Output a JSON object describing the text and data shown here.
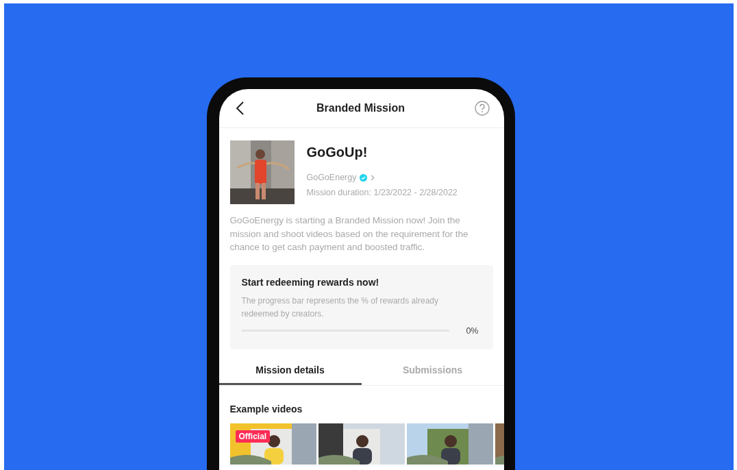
{
  "header": {
    "title": "Branded Mission"
  },
  "mission": {
    "name": "GoGoUp!",
    "brand": "GoGoEnergy",
    "verified": true,
    "duration": "Mission duration: 1/23/2022 - 2/28/2022",
    "description": "GoGoEnergy is starting a Branded Mission now! Join the mission and shoot videos based on the requirement for the chance to get cash payment and boosted traffic."
  },
  "rewards": {
    "title": "Start redeeming rewards now!",
    "note": "The progress bar represents the % of rewards already redeemed by creators.",
    "level": 0,
    "reading": "0%"
  },
  "tabs": [
    {
      "label": "Mission details",
      "selected": true
    },
    {
      "label": "Submissions",
      "selected": false
    }
  ],
  "examples": {
    "title": "Example videos",
    "videos": [
      {
        "kind": "picture",
        "badge": "Official"
      },
      {
        "kind": "picture"
      },
      {
        "kind": "picture"
      },
      {
        "kind": "picture"
      }
    ]
  }
}
